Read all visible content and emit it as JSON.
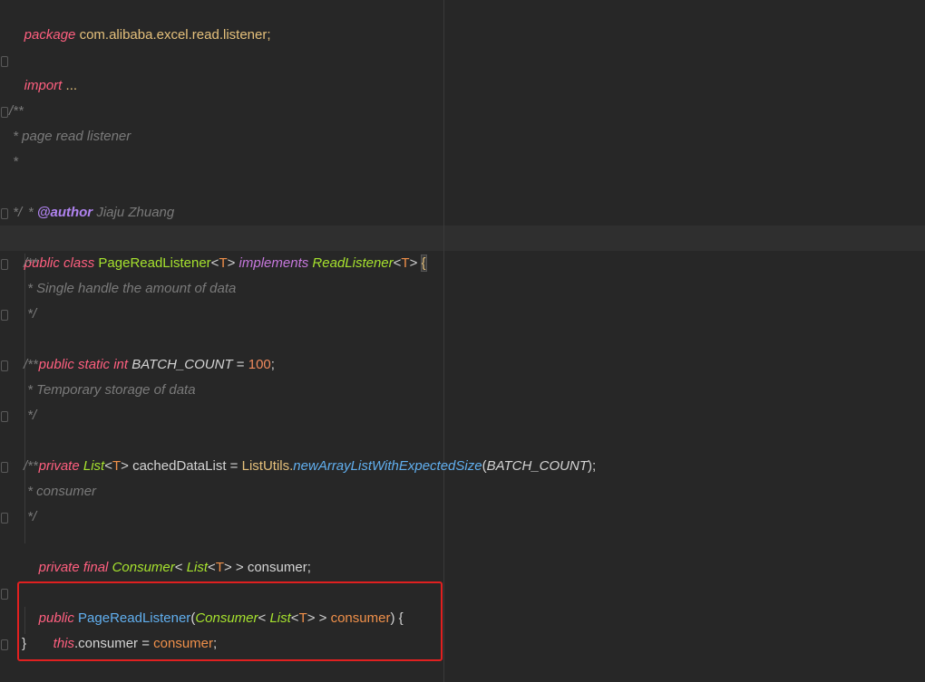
{
  "code": {
    "l1_kw": "package",
    "l1_pkg": "com.alibaba.excel.read.listener;",
    "l2_kw": "import",
    "l2_rest": " ...",
    "l3": "/**",
    "l4": " * page read listener",
    "l5": " *",
    "l6_pre": " * ",
    "l6_tag": "@author",
    "l6_rest": " Jiaju Zhuang",
    "l7": " */",
    "l8": {
      "public": "public",
      "class": "class",
      "name": "PageReadListener",
      "lt": "<",
      "t": "T",
      "gt": ">",
      "implements": "implements",
      "iface": "ReadListener",
      "lt2": "<",
      "t2": "T",
      "gt2": ">",
      "brace": "{"
    },
    "l9": "/**",
    "l10": " * Single handle the amount of data",
    "l11": " */",
    "l12": {
      "kw": "public static int",
      "name": "BATCH_COUNT",
      "eq": " = ",
      "num": "100",
      "semi": ";"
    },
    "l13": "/**",
    "l14": " * Temporary storage of data",
    "l15": " */",
    "l16": {
      "kw": "private",
      "list": "List",
      "lt": "<",
      "t": "T",
      "gt": "> ",
      "name": "cachedDataList",
      "eq": " = ",
      "utils": "ListUtils.",
      "method": "newArrayListWithExpectedSize",
      "open": "(",
      "arg": "BATCH_COUNT",
      "close": ");"
    },
    "l17": "/**",
    "l18": " * consumer",
    "l19": " */",
    "l20": {
      "kw": "private final",
      "consumer": "Consumer",
      "lt": "< ",
      "list": "List",
      "lt2": "<",
      "t": "T",
      "gt": "> > ",
      "name": "consumer;"
    },
    "l22": {
      "kw": "public",
      "name": "PageReadListener",
      "open": "(",
      "consumer": "Consumer",
      "lt": "< ",
      "list": "List",
      "lt2": "<",
      "t": "T",
      "gt": "> > ",
      "param": "consumer",
      "close": ") {"
    },
    "l23": {
      "this": "this",
      "dot": ".consumer = ",
      "param": "consumer",
      "semi": ";"
    },
    "l24": "}"
  }
}
